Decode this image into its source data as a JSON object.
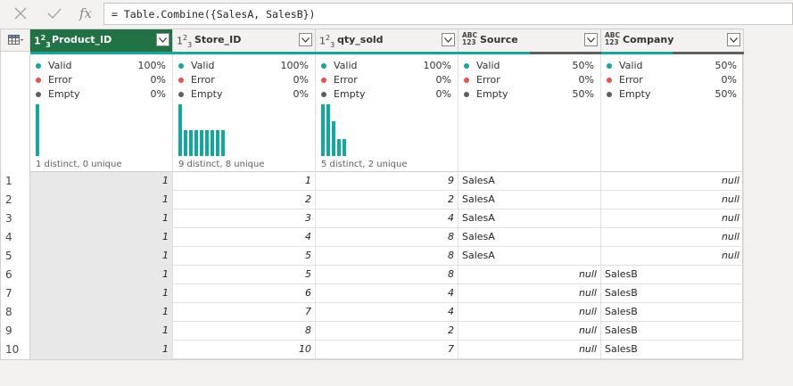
{
  "formula_bar": {
    "formula": "= Table.Combine({SalesA, SalesB})",
    "fx_label": "fx"
  },
  "columns": [
    {
      "name": "Product_ID",
      "type_icon": "123",
      "type": "number",
      "selected": true,
      "stats": {
        "valid_label": "Valid",
        "valid": "100%",
        "error_label": "Error",
        "error": "0%",
        "empty_label": "Empty",
        "empty": "0%"
      },
      "distinct": "1 distinct, 0 unique",
      "histogram": [
        1.0
      ],
      "valid_fraction": 1.0
    },
    {
      "name": "Store_ID",
      "type_icon": "123",
      "type": "number",
      "selected": false,
      "stats": {
        "valid_label": "Valid",
        "valid": "100%",
        "error_label": "Error",
        "error": "0%",
        "empty_label": "Empty",
        "empty": "0%"
      },
      "distinct": "9 distinct, 8 unique",
      "histogram": [
        1.0,
        0.5,
        0.5,
        0.5,
        0.5,
        0.5,
        0.5,
        0.5,
        0.5
      ],
      "valid_fraction": 1.0
    },
    {
      "name": "qty_sold",
      "type_icon": "123",
      "type": "number",
      "selected": false,
      "stats": {
        "valid_label": "Valid",
        "valid": "100%",
        "error_label": "Error",
        "error": "0%",
        "empty_label": "Empty",
        "empty": "0%"
      },
      "distinct": "5 distinct, 2 unique",
      "histogram": [
        1.0,
        1.0,
        0.67,
        0.33,
        0.33
      ],
      "valid_fraction": 1.0
    },
    {
      "name": "Source",
      "type_icon": "ABC\n123",
      "type": "any",
      "selected": false,
      "stats": {
        "valid_label": "Valid",
        "valid": "50%",
        "error_label": "Error",
        "error": "0%",
        "empty_label": "Empty",
        "empty": "50%"
      },
      "distinct": "",
      "histogram": [],
      "valid_fraction": 0.5
    },
    {
      "name": "Company",
      "type_icon": "ABC\n123",
      "type": "any",
      "selected": false,
      "stats": {
        "valid_label": "Valid",
        "valid": "50%",
        "error_label": "Error",
        "error": "0%",
        "empty_label": "Empty",
        "empty": "50%"
      },
      "distinct": "",
      "histogram": [],
      "valid_fraction": 0.5
    }
  ],
  "rows": [
    {
      "n": "1",
      "values": [
        "1",
        "1",
        "9",
        "SalesA",
        "null"
      ]
    },
    {
      "n": "2",
      "values": [
        "1",
        "2",
        "2",
        "SalesA",
        "null"
      ]
    },
    {
      "n": "3",
      "values": [
        "1",
        "3",
        "4",
        "SalesA",
        "null"
      ]
    },
    {
      "n": "4",
      "values": [
        "1",
        "4",
        "8",
        "SalesA",
        "null"
      ]
    },
    {
      "n": "5",
      "values": [
        "1",
        "5",
        "8",
        "SalesA",
        "null"
      ]
    },
    {
      "n": "6",
      "values": [
        "1",
        "5",
        "8",
        "null",
        "SalesB"
      ]
    },
    {
      "n": "7",
      "values": [
        "1",
        "6",
        "4",
        "null",
        "SalesB"
      ]
    },
    {
      "n": "8",
      "values": [
        "1",
        "7",
        "4",
        "null",
        "SalesB"
      ]
    },
    {
      "n": "9",
      "values": [
        "1",
        "8",
        "2",
        "null",
        "SalesB"
      ]
    },
    {
      "n": "10",
      "values": [
        "1",
        "10",
        "7",
        "null",
        "SalesB"
      ]
    }
  ],
  "colors": {
    "valid": "#12a89d",
    "error": "#e8514a",
    "empty": "#5f5f5f",
    "selected_header": "#217346"
  },
  "icons": {
    "cancel": "close-icon",
    "commit": "checkmark-icon",
    "table_menu": "table-icon",
    "column_dropdown": "chevron-down-icon"
  }
}
